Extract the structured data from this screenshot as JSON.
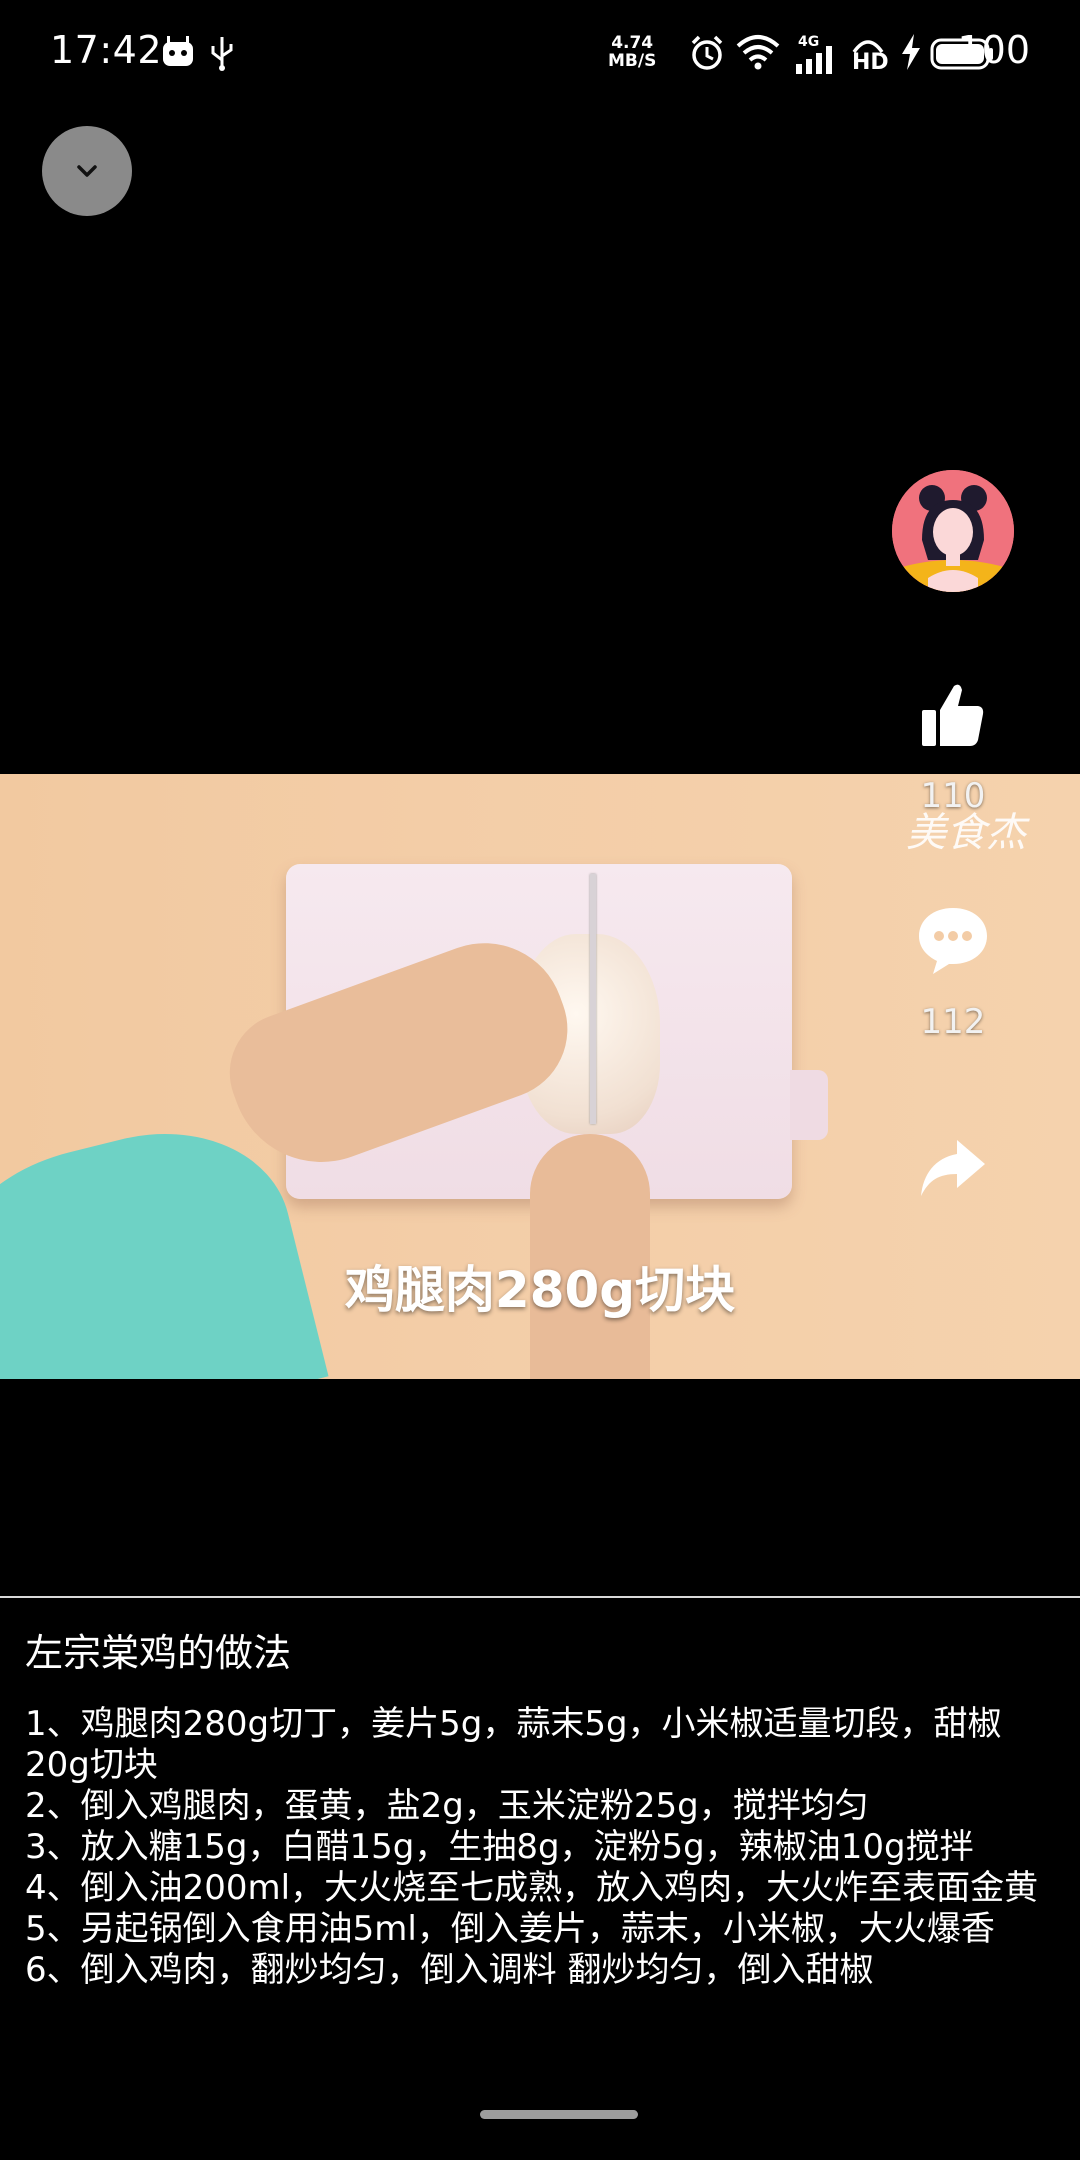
{
  "status_bar": {
    "time": "17:42",
    "network_speed_value": "4.74",
    "network_speed_unit": "MB/S",
    "signal_label": "4G",
    "hd_label": "HD",
    "battery": "100"
  },
  "video": {
    "subtitle": "鸡腿肉280g切块",
    "watermark": "美食杰"
  },
  "actions": {
    "likes": "110",
    "comments": "112"
  },
  "description": {
    "title": "左宗棠鸡的做法",
    "steps": [
      "1、鸡腿肉280g切丁，姜片5g，蒜末5g，小米椒适量切段，甜椒20g切块",
      "2、倒入鸡腿肉，蛋黄，盐2g，玉米淀粉25g，搅拌均匀",
      "3、放入糖15g，白醋15g，生抽8g，淀粉5g，辣椒油10g搅拌",
      "4、倒入油200ml，大火烧至七成熟，放入鸡肉，大火炸至表面金黄",
      "5、另起锅倒入食用油5ml，倒入姜片，蒜末，小米椒，大火爆香",
      "6、倒入鸡肉，翻炒均匀，倒入调料 翻炒均匀，倒入甜椒"
    ]
  },
  "icons": {
    "collapse": "chevron-down-icon",
    "like": "thumbs-up-icon",
    "comment": "comment-icon",
    "share": "share-icon"
  }
}
